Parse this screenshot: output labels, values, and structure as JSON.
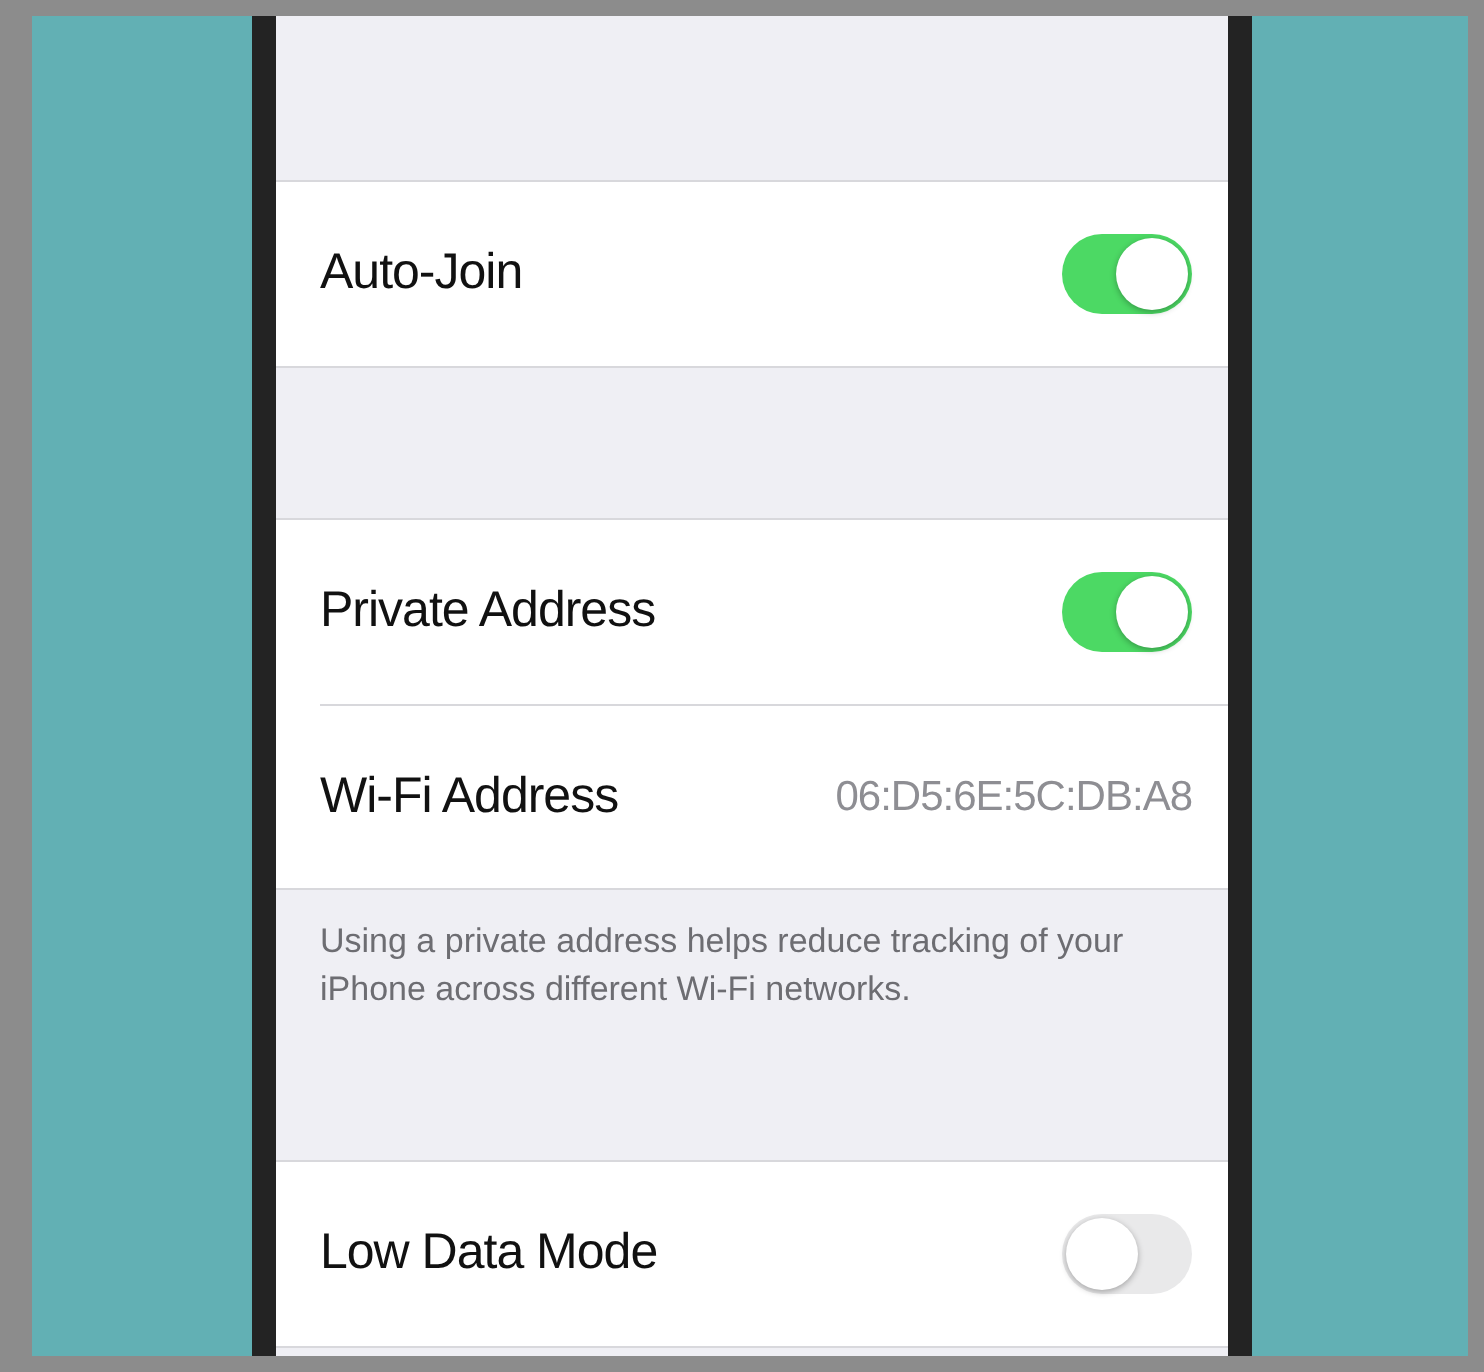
{
  "groups": [
    {
      "rows": [
        {
          "kind": "toggle",
          "label": "Auto-Join",
          "on": true
        }
      ]
    },
    {
      "rows": [
        {
          "kind": "toggle",
          "label": "Private Address",
          "on": true
        },
        {
          "kind": "value",
          "label": "Wi-Fi Address",
          "value": "06:D5:6E:5C:DB:A8"
        }
      ],
      "footer": "Using a private address helps reduce tracking of your iPhone across different Wi-Fi networks."
    },
    {
      "rows": [
        {
          "kind": "toggle",
          "label": "Low Data Mode",
          "on": false
        }
      ]
    }
  ]
}
